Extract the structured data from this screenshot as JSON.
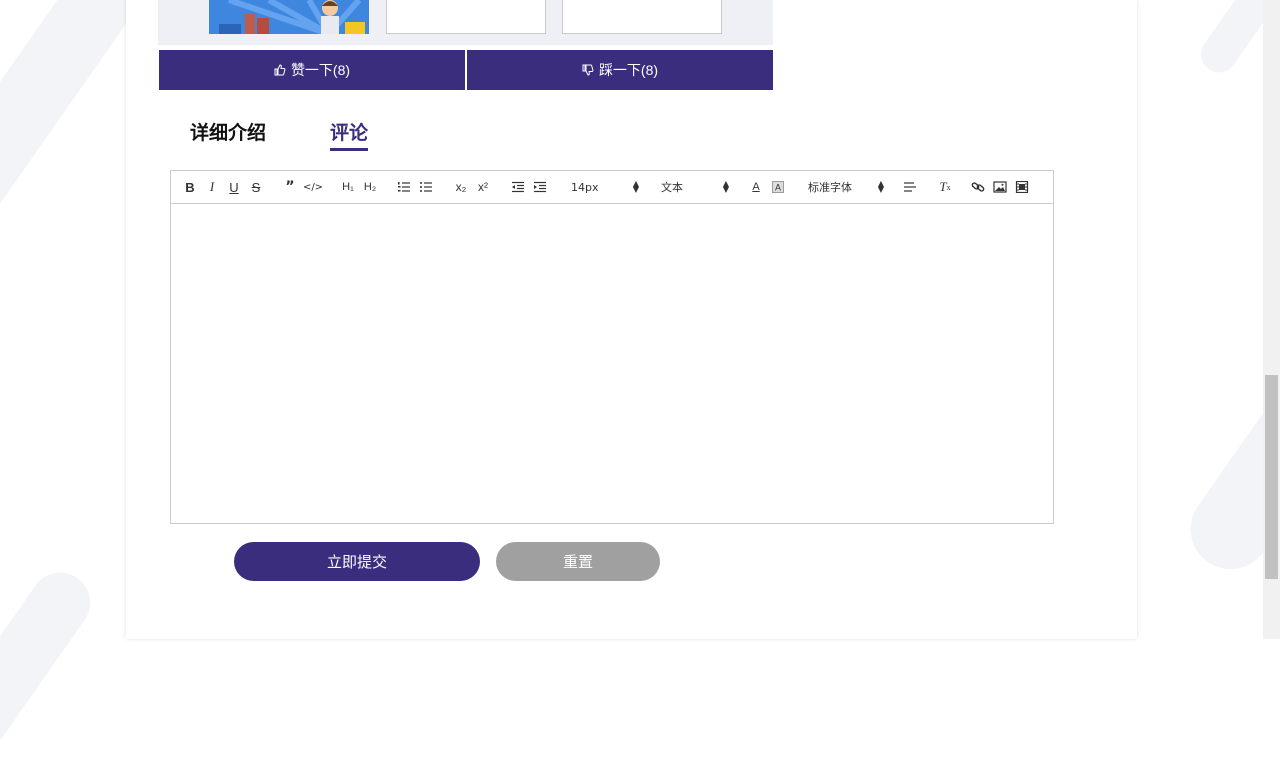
{
  "vote": {
    "like_label": "赞一下(8)",
    "dislike_label": "踩一下(8)"
  },
  "tabs": [
    {
      "label": "详细介绍",
      "active": false
    },
    {
      "label": "评论",
      "active": true
    }
  ],
  "editor": {
    "font_size_value": "14px",
    "header_value": "文本",
    "font_family_value": "标准字体"
  },
  "form": {
    "submit_label": "立即提交",
    "reset_label": "重置"
  },
  "colors": {
    "primary": "#3b2d7e",
    "reset": "#a0a0a0"
  }
}
